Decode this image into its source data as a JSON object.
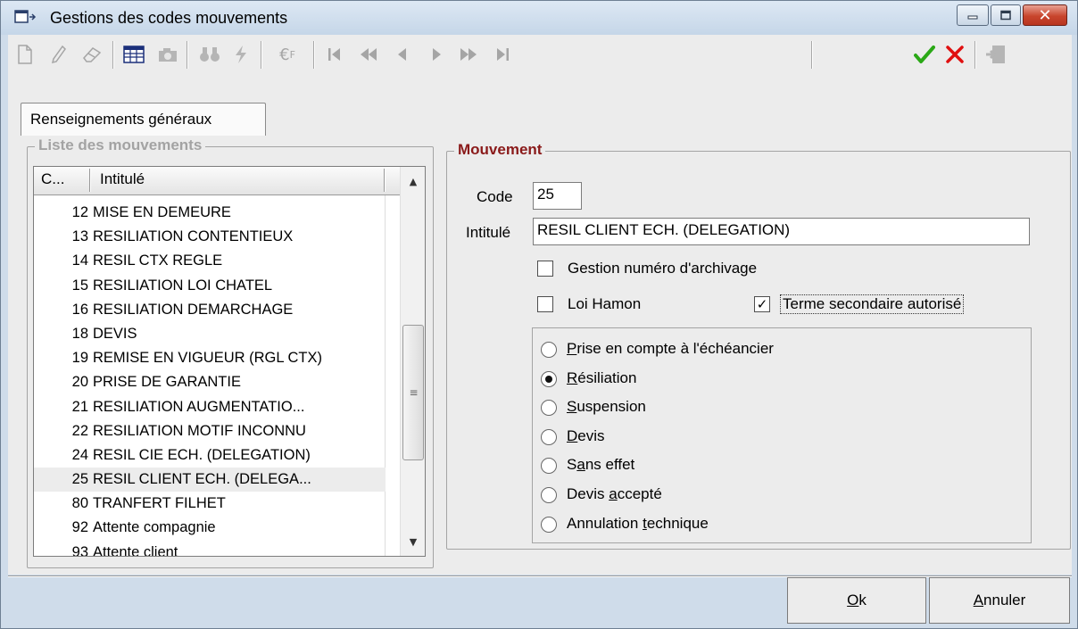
{
  "window": {
    "title": "Gestions des codes mouvements",
    "icons": {
      "app": "window-app-icon",
      "minimize": "minimize-icon",
      "maximize": "maximize-icon",
      "close": "close-icon"
    }
  },
  "toolbar": {
    "icons": [
      "new-document-icon",
      "edit-pencil-icon",
      "eraser-icon",
      "table-view-icon",
      "camera-icon",
      "binoculars-search-icon",
      "lightning-icon",
      "euro-currency-icon",
      "first-record-icon",
      "previous-page-icon",
      "previous-record-icon",
      "next-record-icon",
      "next-page-icon",
      "last-record-icon",
      "validate-check-icon",
      "cancel-x-icon",
      "exit-door-icon"
    ],
    "colors": {
      "check": "#2aa816",
      "cross": "#e01010",
      "disabled": "#a5a5a5"
    }
  },
  "tab": {
    "label": "Renseignements généraux"
  },
  "list": {
    "legend": "Liste des mouvements",
    "columns": [
      "C...",
      "Intitulé"
    ],
    "rows": [
      {
        "code": "12",
        "label": "MISE EN DEMEURE"
      },
      {
        "code": "13",
        "label": "RESILIATION CONTENTIEUX"
      },
      {
        "code": "14",
        "label": "RESIL CTX REGLE"
      },
      {
        "code": "15",
        "label": "RESILIATION LOI CHATEL"
      },
      {
        "code": "16",
        "label": "RESILIATION DEMARCHAGE"
      },
      {
        "code": "18",
        "label": "DEVIS"
      },
      {
        "code": "19",
        "label": "REMISE EN VIGUEUR (RGL CTX)"
      },
      {
        "code": "20",
        "label": "PRISE DE GARANTIE"
      },
      {
        "code": "21",
        "label": "RESILIATION AUGMENTATIO..."
      },
      {
        "code": "22",
        "label": "RESILIATION MOTIF INCONNU"
      },
      {
        "code": "24",
        "label": "RESIL CIE ECH. (DELEGATION)"
      },
      {
        "code": "25",
        "label": "RESIL CLIENT ECH. (DELEGA...",
        "selected": true
      },
      {
        "code": "80",
        "label": "TRANFERT FILHET"
      },
      {
        "code": "92",
        "label": "Attente compagnie"
      },
      {
        "code": "93",
        "label": "Attente client"
      }
    ]
  },
  "mouvement": {
    "legend": "Mouvement",
    "legend_color": "#8a1a1a",
    "code_label": "Code",
    "code_value": "25",
    "intitule_label": "Intitulé",
    "intitule_value": "RESIL CLIENT ECH. (DELEGATION)",
    "checkboxes": {
      "archivage": {
        "label": "Gestion numéro d'archivage",
        "checked": false
      },
      "hamon": {
        "label": "Loi Hamon",
        "checked": false
      },
      "terme": {
        "label": "Terme secondaire autorisé",
        "checked": true
      }
    },
    "radios": [
      {
        "pre": "",
        "key": "P",
        "post": "rise en compte à l'échéancier",
        "checked": false
      },
      {
        "pre": "",
        "key": "R",
        "post": "ésiliation",
        "checked": true
      },
      {
        "pre": "",
        "key": "S",
        "post": "uspension",
        "checked": false
      },
      {
        "pre": "",
        "key": "D",
        "post": "evis",
        "checked": false
      },
      {
        "pre": "S",
        "key": "a",
        "post": "ns effet",
        "checked": false
      },
      {
        "pre": "Devis ",
        "key": "a",
        "post": "ccepté",
        "checked": false
      },
      {
        "pre": "Annulation ",
        "key": "t",
        "post": "echnique",
        "checked": false
      }
    ]
  },
  "buttons": {
    "ok": {
      "key": "O",
      "rest": "k"
    },
    "cancel": {
      "key": "A",
      "rest": "nnuler"
    }
  }
}
